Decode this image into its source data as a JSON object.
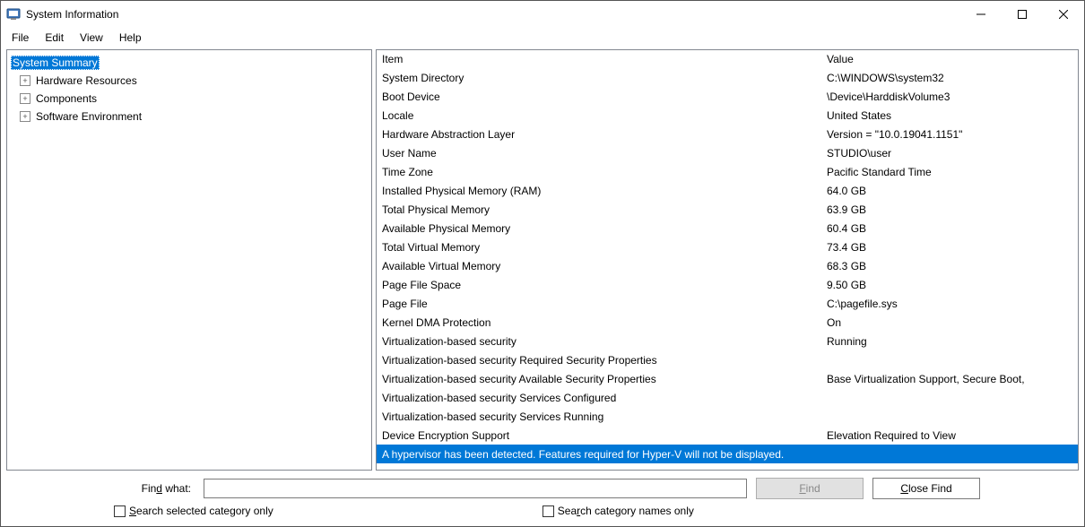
{
  "title": "System Information",
  "menu": {
    "file": "File",
    "edit": "Edit",
    "view": "View",
    "help": "Help"
  },
  "tree": {
    "root": "System Summary",
    "children": [
      {
        "label": "Hardware Resources"
      },
      {
        "label": "Components"
      },
      {
        "label": "Software Environment"
      }
    ]
  },
  "list": {
    "headers": {
      "item": "Item",
      "value": "Value"
    },
    "rows": [
      {
        "item": "System Directory",
        "value": "C:\\WINDOWS\\system32"
      },
      {
        "item": "Boot Device",
        "value": "\\Device\\HarddiskVolume3"
      },
      {
        "item": "Locale",
        "value": "United States"
      },
      {
        "item": "Hardware Abstraction Layer",
        "value": "Version = \"10.0.19041.1151\""
      },
      {
        "item": "User Name",
        "value": "STUDIO\\user"
      },
      {
        "item": "Time Zone",
        "value": "Pacific Standard Time"
      },
      {
        "item": "Installed Physical Memory (RAM)",
        "value": "64.0 GB"
      },
      {
        "item": "Total Physical Memory",
        "value": "63.9 GB"
      },
      {
        "item": "Available Physical Memory",
        "value": "60.4 GB"
      },
      {
        "item": "Total Virtual Memory",
        "value": "73.4 GB"
      },
      {
        "item": "Available Virtual Memory",
        "value": "68.3 GB"
      },
      {
        "item": "Page File Space",
        "value": "9.50 GB"
      },
      {
        "item": "Page File",
        "value": "C:\\pagefile.sys"
      },
      {
        "item": "Kernel DMA Protection",
        "value": "On"
      },
      {
        "item": "Virtualization-based security",
        "value": "Running"
      },
      {
        "item": "Virtualization-based security Required Security Properties",
        "value": ""
      },
      {
        "item": "Virtualization-based security Available Security Properties",
        "value": "Base Virtualization Support, Secure Boot,"
      },
      {
        "item": "Virtualization-based security Services Configured",
        "value": ""
      },
      {
        "item": "Virtualization-based security Services Running",
        "value": ""
      },
      {
        "item": "Device Encryption Support",
        "value": "Elevation Required to View"
      },
      {
        "item": "A hypervisor has been detected. Features required for Hyper-V will not be displayed.",
        "value": "",
        "highlight": true,
        "span": true
      }
    ]
  },
  "find": {
    "label_prefix": "Fin",
    "label_underline": "d",
    "label_suffix": " what:",
    "find_prefix": "",
    "find_underline": "F",
    "find_suffix": "ind",
    "close_prefix": "",
    "close_underline": "C",
    "close_suffix": "lose Find",
    "cb1_prefix": "",
    "cb1_underline": "S",
    "cb1_suffix": "earch selected category only",
    "cb2_prefix": "Sea",
    "cb2_underline": "r",
    "cb2_suffix": "ch category names only"
  }
}
